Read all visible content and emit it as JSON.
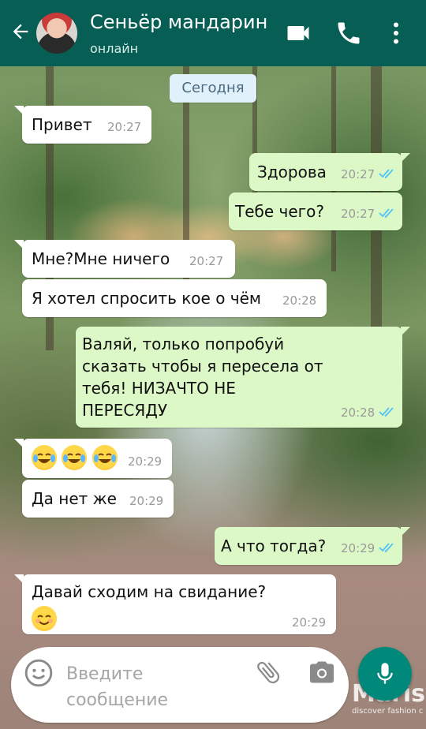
{
  "header": {
    "contact_name": "Сеньёр мандарин",
    "status": "онлайн",
    "bg_color": "#075e54"
  },
  "date_chip": "Сегодня",
  "messages": [
    {
      "dir": "in",
      "lines": [
        "Привет"
      ],
      "time": "20:27"
    },
    {
      "dir": "out",
      "lines": [
        "Здорова"
      ],
      "time": "20:27",
      "read": true
    },
    {
      "dir": "out",
      "lines": [
        "Тебе чего?"
      ],
      "time": "20:27",
      "read": true
    },
    {
      "dir": "in",
      "lines": [
        "Мне?Мне ничего"
      ],
      "time": "20:27"
    },
    {
      "dir": "in",
      "lines": [
        "Я хотел спросить кое о чём"
      ],
      "time": "20:28"
    },
    {
      "dir": "out",
      "lines": [
        "Валяй, только попробуй",
        "сказать чтобы я пересела от",
        "тебя! НИЗАЧТО НЕ",
        "ПЕРЕСЯДУ"
      ],
      "time": "20:28",
      "read": true
    },
    {
      "dir": "in",
      "emoji": [
        "face-with-tears-of-joy",
        "face-with-tears-of-joy",
        "face-with-tears-of-joy"
      ],
      "time": "20:29"
    },
    {
      "dir": "in",
      "lines": [
        "Да нет же"
      ],
      "time": "20:29"
    },
    {
      "dir": "out",
      "lines": [
        "А что тогда?"
      ],
      "time": "20:29",
      "read": true
    },
    {
      "dir": "in",
      "lines": [
        "Давай сходим на свидание?"
      ],
      "emoji": [
        "smiling-face-with-smiling-eyes"
      ],
      "time": "20:29"
    }
  ],
  "input": {
    "placeholder_line1": "Введите",
    "placeholder_line2": "сообщение"
  },
  "watermark": {
    "brand": "Marish",
    "tagline": "discover fashion c"
  },
  "colors": {
    "incoming": "#ffffff",
    "outgoing": "#dcf8c6",
    "ticks": "#4fc3f7",
    "accent": "#00897b"
  }
}
